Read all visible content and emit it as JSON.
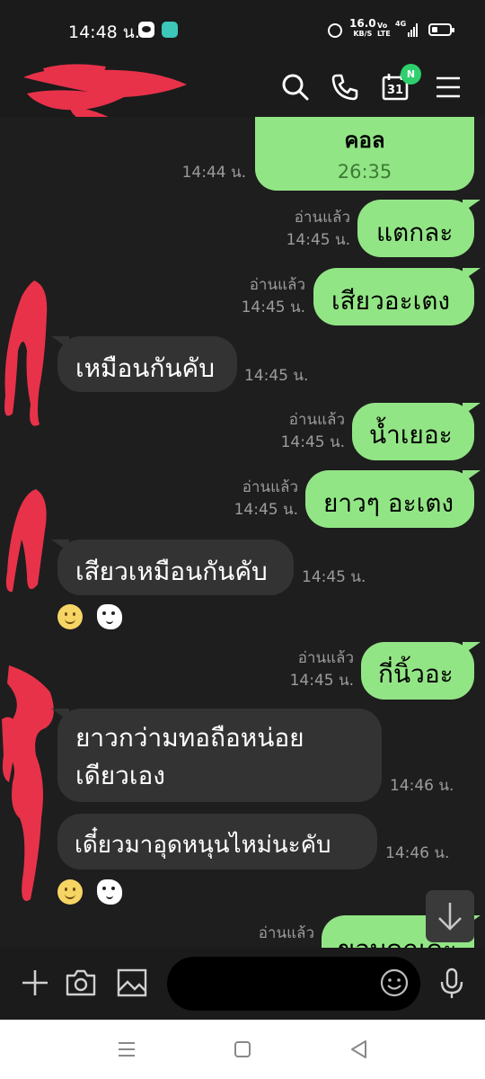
{
  "status_bar": {
    "time": "14:48 น.",
    "net_speed_value": "16.0",
    "net_speed_unit": "KB/S",
    "volte_top": "Vo",
    "volte_bottom": "LTE",
    "signal_label": "4G"
  },
  "header": {
    "calendar_day": "31",
    "calendar_badge": "N"
  },
  "messages": [
    {
      "dir": "out",
      "title": "คอล",
      "duration": "26:35",
      "time": "14:44 น."
    },
    {
      "dir": "out",
      "text": "แตกละ",
      "read": "อ่านแล้ว",
      "time": "14:45 น."
    },
    {
      "dir": "out",
      "text": "เสียวอะเตง",
      "read": "อ่านแล้ว",
      "time": "14:45 น."
    },
    {
      "dir": "in",
      "text": "เหมือนกันคับ",
      "time": "14:45 น."
    },
    {
      "dir": "out",
      "text": "น้ำเยอะ",
      "read": "อ่านแล้ว",
      "time": "14:45 น."
    },
    {
      "dir": "out",
      "text": "ยาวๆ อะเตง",
      "read": "อ่านแล้ว",
      "time": "14:45 น."
    },
    {
      "dir": "in",
      "text": "เสียวเหมือนกันคับ",
      "time": "14:45 น."
    },
    {
      "dir": "out",
      "text": "กี่นิ้วอะ",
      "read": "อ่านแล้ว",
      "time": "14:45 น."
    },
    {
      "dir": "in",
      "line1": "ยาวกว่ามทอถือหน่อย",
      "line2": "เดียวเอง",
      "time": "14:46 น."
    },
    {
      "dir": "in",
      "text": "เดี๋ยวมาอุดหนุนไหม่นะคับ",
      "time": "14:46 น."
    },
    {
      "dir": "out",
      "text": "ขอบคุณคะ",
      "read": "อ่านแล้ว"
    }
  ],
  "colors": {
    "outgoing_bubble": "#92e585",
    "incoming_bubble": "#333333",
    "chat_background": "#1e1e1e",
    "header_background": "#1b1b1b",
    "redaction": "#e8324a",
    "badge": "#2fcf6e"
  },
  "icons": {
    "header": [
      "search-icon",
      "phone-icon",
      "calendar-icon",
      "menu-icon"
    ],
    "input_bar": [
      "add-icon",
      "camera-icon",
      "image-icon",
      "emoji-icon",
      "microphone-icon"
    ],
    "nav_bar": [
      "recent-apps-icon",
      "home-icon",
      "back-icon"
    ]
  }
}
